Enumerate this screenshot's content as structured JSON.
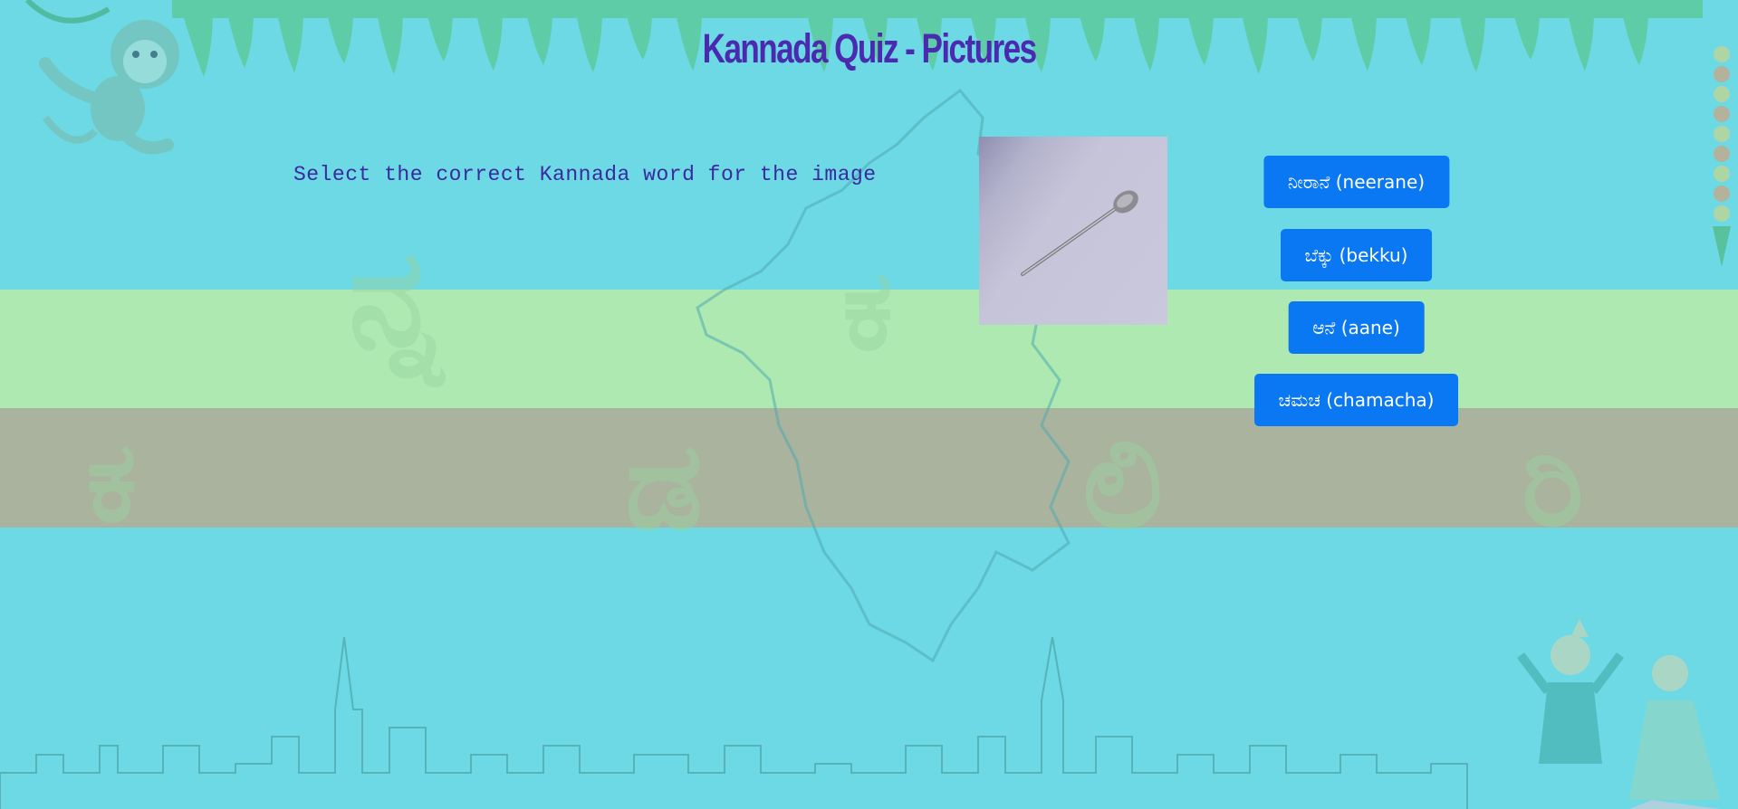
{
  "page": {
    "title": "Kannada Quiz - Pictures",
    "prompt": "Select the correct Kannada word for the image"
  },
  "quiz_image": {
    "alt": "spoon",
    "icon": "spoon-image"
  },
  "options": [
    {
      "label": "ನೀರಾನೆ (neerane)"
    },
    {
      "label": "ಬೆಕ್ಕು (bekku)"
    },
    {
      "label": "ಆನೆ (aane)"
    },
    {
      "label": "ಚಮಚ (chamacha)"
    }
  ],
  "colors": {
    "background": "#6cd9e4",
    "band_green": "#ade9b0",
    "band_tan": "#a9b39e",
    "title": "#4a2bb0",
    "prompt": "#3a2aa0",
    "button": "#0a78f2",
    "button_text": "#ffffff"
  },
  "background_decor": {
    "glyphs": [
      "ನ್ನ",
      "ಕ",
      "ಡ",
      "ಕ",
      "ಡ",
      "ಲಿ",
      "ರಿ"
    ]
  }
}
